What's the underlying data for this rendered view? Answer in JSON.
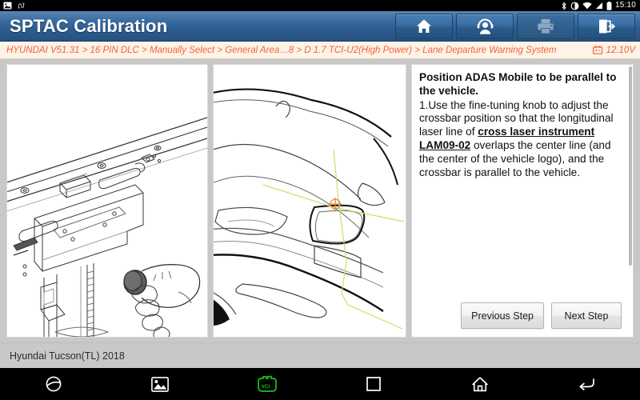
{
  "status_bar": {
    "icons": [
      "bluetooth-icon",
      "screen-rotation-icon",
      "wifi-icon",
      "signal-icon",
      "battery-icon"
    ],
    "time": "15:10"
  },
  "title_bar": {
    "app_title": "SPTAC Calibration",
    "buttons": [
      {
        "name": "home-button",
        "icon": "home-icon",
        "enabled": true
      },
      {
        "name": "support-button",
        "icon": "headset-person-icon",
        "enabled": true
      },
      {
        "name": "print-button",
        "icon": "printer-icon",
        "enabled": false
      },
      {
        "name": "exit-button",
        "icon": "exit-door-icon",
        "enabled": true
      }
    ]
  },
  "breadcrumb": {
    "path": "HYUNDAI V51.31 > 16 PIN DLC > Manually Select > General Area…8 > D 1.7 TCI-U2(High Power) > Lane Departure Warning System",
    "battery_icon": "battery-icon",
    "voltage": "12.10V"
  },
  "main": {
    "illustration_left": {
      "name": "crossbar-knob-illustration",
      "alt": "Hand turning the fine-tuning knob on the ADAS crossbar rail assembly"
    },
    "illustration_right": {
      "name": "vehicle-laser-alignment-illustration",
      "alt": "Vehicle front with cross laser lines over the center of the vehicle logo",
      "laser_color": "#c8e06a",
      "crosshair_color": "#e08a3c"
    },
    "instruction": {
      "title": "Position ADAS Mobile to be parallel to the vehicle.",
      "body_part1": "1.Use the fine-tuning knob to adjust the crossbar position so that the longitudinal laser line of ",
      "body_emphasis": "cross laser instrument LAM09-02",
      "body_part2": " overlaps the center line (and the center of the vehicle logo), and the crossbar is parallel to the vehicle."
    },
    "buttons": {
      "previous_label": "Previous Step",
      "next_label": "Next Step"
    }
  },
  "vehicle_bar": {
    "vehicle": "Hyundai Tucson(TL) 2018"
  },
  "nav_bar": {
    "items": [
      "browser-icon",
      "gallery-icon",
      "vci-icon",
      "recents-icon",
      "home-icon",
      "back-icon"
    ],
    "vci_label": "VCI",
    "vci_color": "#17c217"
  },
  "colors": {
    "title_blue": "#2d5c90",
    "breadcrumb_orange": "#f4613c",
    "breadcrumb_bg": "#fdf3e7",
    "page_bg": "#c8c8c8"
  }
}
